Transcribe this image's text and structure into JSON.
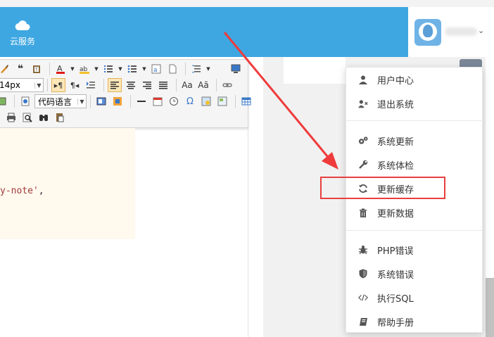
{
  "header": {
    "cloud_label": "云服务"
  },
  "editor": {
    "font_size": "14px",
    "code_language": "代码语言",
    "code_text": "y-note'",
    "code_comma": ","
  },
  "menu": {
    "items": [
      {
        "label": "用户中心",
        "icon": "user-icon"
      },
      {
        "label": "退出系统",
        "icon": "user-x-icon"
      },
      {
        "label": "系统更新",
        "icon": "gears-icon"
      },
      {
        "label": "系统体检",
        "icon": "wrench-icon"
      },
      {
        "label": "更新缓存",
        "icon": "refresh-icon"
      },
      {
        "label": "更新数据",
        "icon": "trash-icon"
      },
      {
        "label": "PHP错误",
        "icon": "bug-icon"
      },
      {
        "label": "系统错误",
        "icon": "shield-icon"
      },
      {
        "label": "执行SQL",
        "icon": "code-icon"
      },
      {
        "label": "帮助手册",
        "icon": "book-icon"
      }
    ]
  },
  "colors": {
    "header_blue": "#3ea7e2",
    "highlight_red": "#e83f3f"
  }
}
